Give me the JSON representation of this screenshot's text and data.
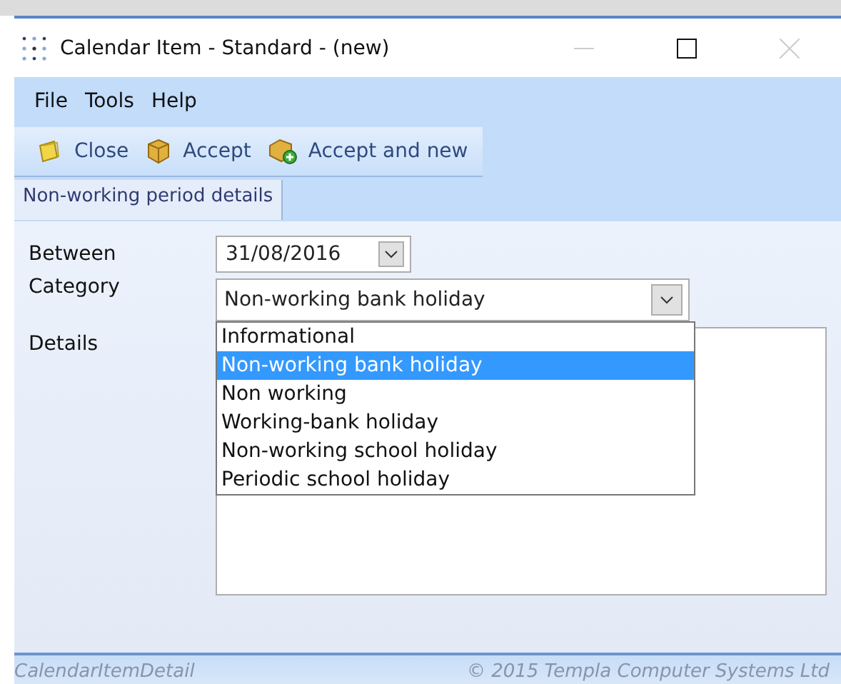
{
  "window": {
    "title": "Calendar Item - Standard - (new)"
  },
  "menu": [
    "File",
    "Tools",
    "Help"
  ],
  "toolbar": [
    {
      "kind": "close",
      "label": "Close"
    },
    {
      "kind": "accept",
      "label": "Accept"
    },
    {
      "kind": "accept_new",
      "label": "Accept and new"
    }
  ],
  "tabs": [
    {
      "label": "Non-working period details",
      "selected": true
    }
  ],
  "form": {
    "between_label": "Between",
    "between_value": "31/08/2016",
    "category_label": "Category",
    "category_value": "Non-working bank holiday",
    "details_label": "Details",
    "category_options": [
      {
        "label": "Informational",
        "selected": false
      },
      {
        "label": "Non-working bank holiday",
        "selected": true
      },
      {
        "label": "Non working",
        "selected": false
      },
      {
        "label": "Working-bank holiday",
        "selected": false
      },
      {
        "label": "Non-working school holiday",
        "selected": false
      },
      {
        "label": "Periodic school holiday",
        "selected": false
      }
    ],
    "dropdown_open": true
  },
  "status_bar": {
    "left": "CalendarItemDetail",
    "right": "© 2015 Templa Computer Systems Ltd"
  }
}
